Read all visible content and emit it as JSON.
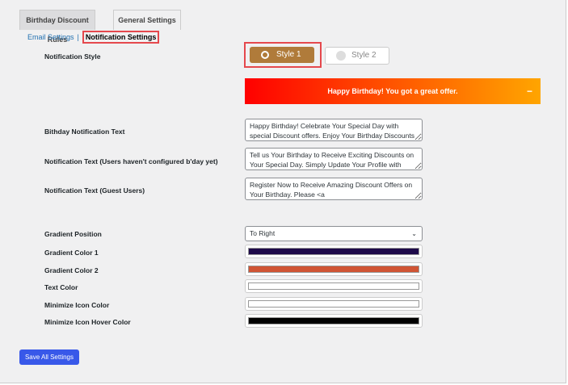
{
  "tabs": [
    {
      "label": "Birthday Discount Rules"
    },
    {
      "label": "General Settings"
    }
  ],
  "subnav": {
    "email": "Email Settings",
    "sep": "|",
    "notification": "Notification Settings"
  },
  "labels": {
    "style": "Notification Style",
    "bday_text": "Bithday Notification Text",
    "unconfigured_text": "Notification Text (Users haven't configured b'day yet)",
    "guest_text": "Notification Text (Guest Users)",
    "gradient_position": "Gradient Position",
    "gradient1": "Gradient Color 1",
    "gradient2": "Gradient Color 2",
    "text_color": "Text Color",
    "min_icon": "Minimize Icon Color",
    "min_icon_hover": "Minimize Icon Hover Color"
  },
  "styles": {
    "style1": "Style 1",
    "style2": "Style 2",
    "selected": "Style 1"
  },
  "preview": {
    "text": "Happy Birthday! You got a great offer.",
    "minimize": "−"
  },
  "fields": {
    "bday_text": "Happy Birthday! Celebrate Your Special Day with special Discount offers. Enjoy Your Birthday Discounts",
    "unconfigured_text": "Tell us Your Birthday to Receive Exciting Discounts on Your Special Day. Simply Update Your Profile with",
    "guest_text": "Register Now to Receive Amazing Discount Offers on Your Birthday. Please <a",
    "gradient_position": "To Right"
  },
  "colors": {
    "gradient1": "#1e0a4a",
    "gradient2": "#d05434",
    "text_color": "#ffffff",
    "min_icon": "#ffffff",
    "min_icon_hover": "#000000"
  },
  "save_label": "Save All Settings"
}
